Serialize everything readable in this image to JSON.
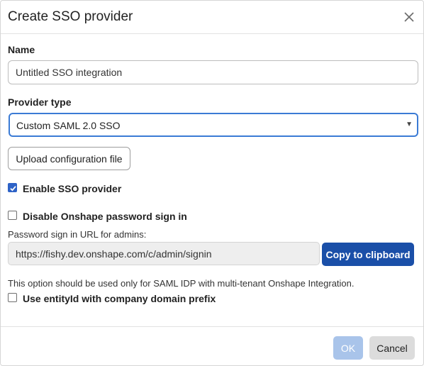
{
  "dialog": {
    "title": "Create SSO provider",
    "close_icon": "close-icon"
  },
  "name": {
    "label": "Name",
    "value": "Untitled SSO integration"
  },
  "provider_type": {
    "label": "Provider type",
    "selected": "Custom SAML 2.0 SSO",
    "caret_icon": "caret-down-icon"
  },
  "upload_button": "Upload configuration file",
  "enable_sso": {
    "label": "Enable SSO provider",
    "checked": true
  },
  "disable_password": {
    "label": "Disable Onshape password sign in",
    "checked": false
  },
  "password_url": {
    "label": "Password sign in URL for admins:",
    "value": "https://fishy.dev.onshape.com/c/admin/signin",
    "copy_button": "Copy to clipboard"
  },
  "entity_id": {
    "note": "This option should be used only for SAML IDP with multi-tenant Onshape Integration.",
    "label": "Use entityId with company domain prefix",
    "checked": false
  },
  "footer": {
    "ok_label": "OK",
    "cancel_label": "Cancel"
  },
  "colors": {
    "primary": "#1a4fa8",
    "checkbox": "#2e63c7",
    "ok_disabled": "#a9c4ea",
    "select_border": "#3b7bd5"
  }
}
